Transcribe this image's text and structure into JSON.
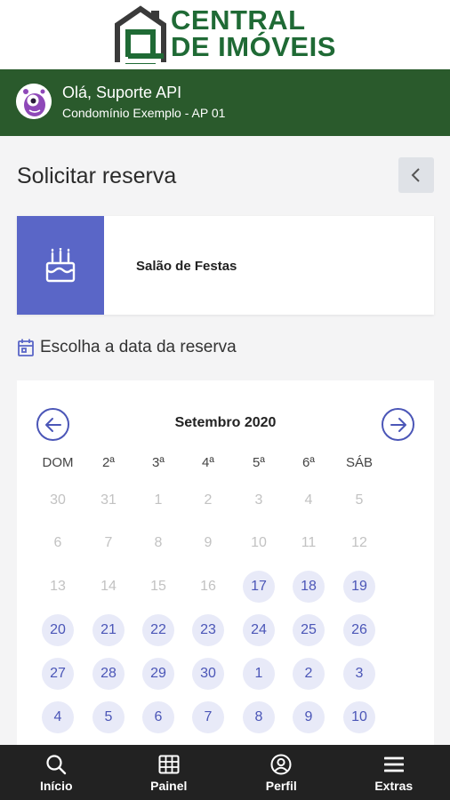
{
  "header": {
    "logo_line1": "CENTRAL",
    "logo_line2": "DE IMÓVEIS",
    "brand_color": "#1f6a35"
  },
  "user": {
    "greeting": "Olá, Suporte API",
    "unit": "Condomínio Exemplo - AP 01",
    "bar_color": "#2a5a2c"
  },
  "page": {
    "title": "Solicitar reserva",
    "back_icon": "chevron-left-icon"
  },
  "venue": {
    "name": "Salão de Festas",
    "icon": "cake-icon",
    "accent": "#5a66c7"
  },
  "date_picker": {
    "label": "Escolha a data da reserva",
    "icon": "calendar-icon",
    "month": "Setembro 2020",
    "weekdays": [
      "DOM",
      "2ª",
      "3ª",
      "4ª",
      "5ª",
      "6ª",
      "SÁB"
    ],
    "weeks": [
      [
        {
          "d": "30",
          "ok": false
        },
        {
          "d": "31",
          "ok": false
        },
        {
          "d": "1",
          "ok": false
        },
        {
          "d": "2",
          "ok": false
        },
        {
          "d": "3",
          "ok": false
        },
        {
          "d": "4",
          "ok": false
        },
        {
          "d": "5",
          "ok": false
        }
      ],
      [
        {
          "d": "6",
          "ok": false
        },
        {
          "d": "7",
          "ok": false
        },
        {
          "d": "8",
          "ok": false
        },
        {
          "d": "9",
          "ok": false
        },
        {
          "d": "10",
          "ok": false
        },
        {
          "d": "11",
          "ok": false
        },
        {
          "d": "12",
          "ok": false
        }
      ],
      [
        {
          "d": "13",
          "ok": false
        },
        {
          "d": "14",
          "ok": false
        },
        {
          "d": "15",
          "ok": false
        },
        {
          "d": "16",
          "ok": false
        },
        {
          "d": "17",
          "ok": true
        },
        {
          "d": "18",
          "ok": true
        },
        {
          "d": "19",
          "ok": true
        }
      ],
      [
        {
          "d": "20",
          "ok": true
        },
        {
          "d": "21",
          "ok": true
        },
        {
          "d": "22",
          "ok": true
        },
        {
          "d": "23",
          "ok": true
        },
        {
          "d": "24",
          "ok": true
        },
        {
          "d": "25",
          "ok": true
        },
        {
          "d": "26",
          "ok": true
        }
      ],
      [
        {
          "d": "27",
          "ok": true
        },
        {
          "d": "28",
          "ok": true
        },
        {
          "d": "29",
          "ok": true
        },
        {
          "d": "30",
          "ok": true
        },
        {
          "d": "1",
          "ok": true
        },
        {
          "d": "2",
          "ok": true
        },
        {
          "d": "3",
          "ok": true
        }
      ],
      [
        {
          "d": "4",
          "ok": true
        },
        {
          "d": "5",
          "ok": true
        },
        {
          "d": "6",
          "ok": true
        },
        {
          "d": "7",
          "ok": true
        },
        {
          "d": "8",
          "ok": true
        },
        {
          "d": "9",
          "ok": true
        },
        {
          "d": "10",
          "ok": true
        }
      ]
    ],
    "prev_icon": "arrow-left-circle-icon",
    "next_icon": "arrow-right-circle-icon",
    "available_color": "#4b56b7"
  },
  "nav": {
    "items": [
      {
        "label": "Início",
        "icon": "search-icon"
      },
      {
        "label": "Painel",
        "icon": "grid-icon"
      },
      {
        "label": "Perfil",
        "icon": "user-circle-icon"
      },
      {
        "label": "Extras",
        "icon": "menu-icon"
      }
    ]
  }
}
